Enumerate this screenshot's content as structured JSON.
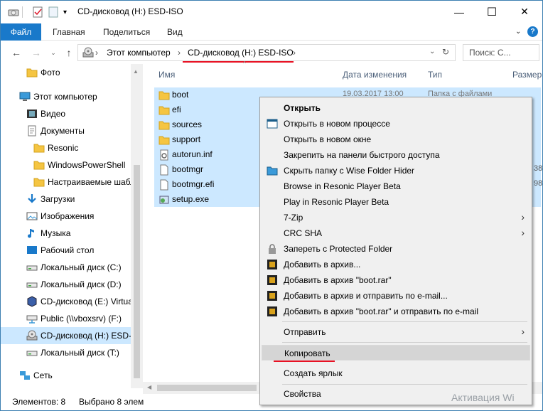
{
  "window": {
    "title": "CD-дисковод (H:) ESD-ISO",
    "minimize": "—",
    "maximize": "☐",
    "close": "✕"
  },
  "ribbon": {
    "tabs": [
      "Файл",
      "Главная",
      "Поделиться",
      "Вид"
    ]
  },
  "address": {
    "crumbs": [
      "Этот компьютер",
      "CD-дисковод (H:) ESD-ISO"
    ],
    "search_placeholder": "Поиск: С..."
  },
  "nav": {
    "items": [
      {
        "label": "Фото",
        "icon": "folder-icon"
      },
      {
        "label": "Этот компьютер",
        "icon": "computer-icon"
      },
      {
        "label": "Видео",
        "icon": "video-icon"
      },
      {
        "label": "Документы",
        "icon": "documents-icon"
      },
      {
        "label": "Resonic",
        "icon": "folder-icon"
      },
      {
        "label": "WindowsPowerShell",
        "icon": "folder-icon"
      },
      {
        "label": "Настраиваемые шабл",
        "icon": "folder-icon"
      },
      {
        "label": "Загрузки",
        "icon": "download-icon"
      },
      {
        "label": "Изображения",
        "icon": "pictures-icon"
      },
      {
        "label": "Музыка",
        "icon": "music-icon"
      },
      {
        "label": "Рабочий стол",
        "icon": "desktop-icon"
      },
      {
        "label": "Локальный диск (C:)",
        "icon": "drive-icon"
      },
      {
        "label": "Локальный диск (D:)",
        "icon": "drive-icon"
      },
      {
        "label": "CD-дисковод (E:) Virtua",
        "icon": "cd-virtualbox-icon"
      },
      {
        "label": "Public (\\\\vboxsrv) (F:)",
        "icon": "network-drive-icon"
      },
      {
        "label": "CD-дисковод (H:) ESD-I",
        "icon": "cd-drive-icon"
      },
      {
        "label": "Локальный диск (T:)",
        "icon": "drive-icon"
      },
      {
        "label": "Сеть",
        "icon": "network-icon"
      }
    ]
  },
  "columns": [
    "Имя",
    "Дата изменения",
    "Тип",
    "Размер"
  ],
  "files": [
    {
      "name": "boot",
      "icon": "folder-icon",
      "date": "19.03.2017 13:00",
      "type": "Папка с файлами",
      "size": ""
    },
    {
      "name": "efi",
      "icon": "folder-icon",
      "size": ""
    },
    {
      "name": "sources",
      "icon": "folder-icon",
      "size": ""
    },
    {
      "name": "support",
      "icon": "folder-icon",
      "size": ""
    },
    {
      "name": "autorun.inf",
      "icon": "settings-file-icon",
      "size": ""
    },
    {
      "name": "bootmgr",
      "icon": "file-icon",
      "size": "38"
    },
    {
      "name": "bootmgr.efi",
      "icon": "file-icon",
      "size": "98"
    },
    {
      "name": "setup.exe",
      "icon": "setup-icon",
      "size": ""
    }
  ],
  "status": {
    "count": "Элементов: 8",
    "selected": "Выбрано 8 элем"
  },
  "context_menu": {
    "items": [
      {
        "label": "Открыть",
        "bold": true
      },
      {
        "label": "Открыть в новом процессе",
        "icon": "window-icon"
      },
      {
        "label": "Открыть в новом окне"
      },
      {
        "label": "Закрепить на панели быстрого доступа"
      },
      {
        "label": "Скрыть папку с Wise Folder Hider",
        "icon": "wise-folder-icon"
      },
      {
        "label": "Browse in Resonic Player Beta"
      },
      {
        "label": "Play in Resonic Player Beta"
      },
      {
        "label": "7-Zip",
        "submenu": true
      },
      {
        "label": "CRC SHA",
        "submenu": true
      },
      {
        "label": "Запереть с Protected Folder",
        "icon": "lock-icon"
      },
      {
        "label": "Добавить в архив...",
        "icon": "winrar-icon"
      },
      {
        "label": "Добавить в архив \"boot.rar\"",
        "icon": "winrar-icon"
      },
      {
        "label": "Добавить в архив и отправить по e-mail...",
        "icon": "winrar-icon"
      },
      {
        "label": "Добавить в архив \"boot.rar\" и отправить по e-mail",
        "icon": "winrar-icon"
      },
      {
        "label": "Отправить",
        "submenu": true
      },
      {
        "label": "Копировать",
        "highlighted": true
      },
      {
        "label": "Создать ярлык"
      },
      {
        "label": "Свойства"
      }
    ]
  },
  "watermark": "Активация Wi",
  "colors": {
    "accent": "#1979ca",
    "selection": "#cce8ff",
    "annotation": "#e81123"
  }
}
